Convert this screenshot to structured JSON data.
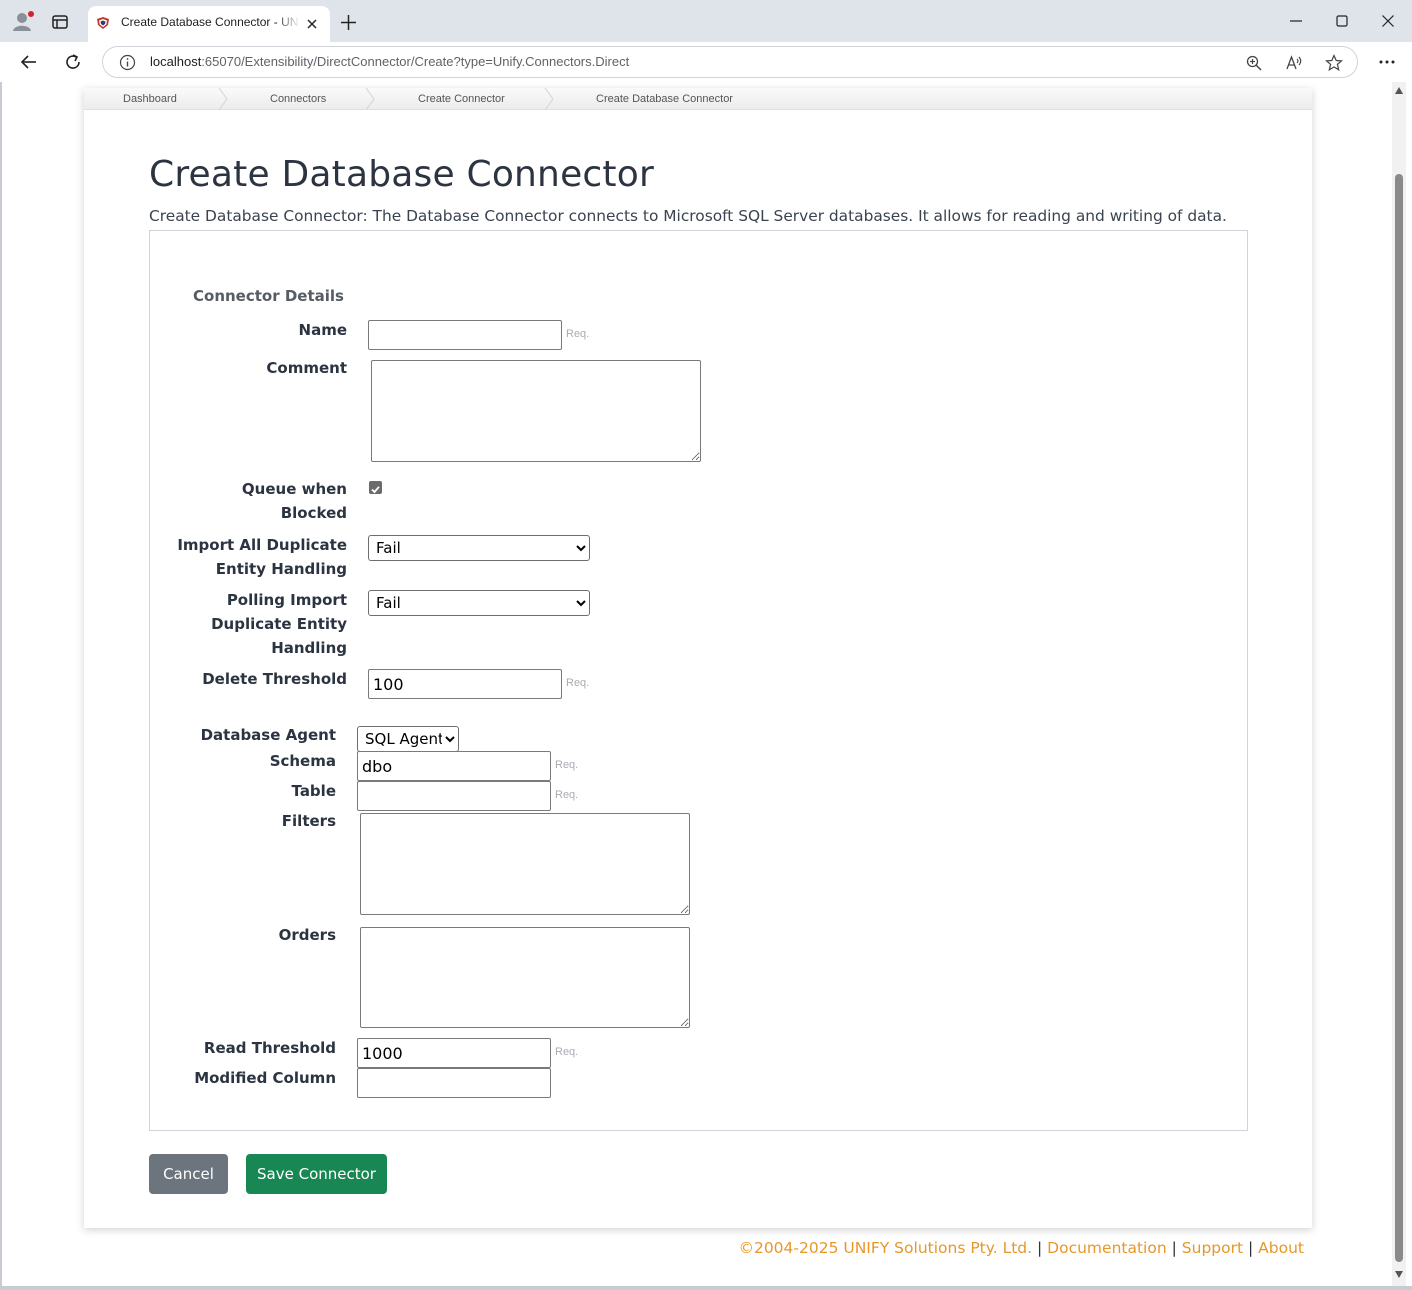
{
  "browser": {
    "tab_title": "Create Database Connector - UNIFY",
    "url_host": "localhost",
    "url_rest": ":65070/Extensibility/DirectConnector/Create?type=Unify.Connectors.Direct",
    "icons": [
      "profile-icon",
      "tab-actions-icon",
      "app-favicon",
      "close-tab-icon",
      "new-tab-icon",
      "minimize-icon",
      "maximize-icon",
      "close-window-icon",
      "back-icon",
      "refresh-icon",
      "info-icon",
      "zoom-icon",
      "read-aloud-icon",
      "favorite-icon",
      "more-icon"
    ]
  },
  "breadcrumb": [
    "Dashboard",
    "Connectors",
    "Create Connector",
    "Create Database Connector"
  ],
  "page": {
    "title": "Create Database Connector",
    "description": "Create Database Connector: The Database Connector connects to Microsoft SQL Server databases. It allows for reading and writing of data."
  },
  "form": {
    "section_title": "Connector Details",
    "required_hint": "Req.",
    "name": {
      "label": "Name",
      "value": ""
    },
    "comment": {
      "label": "Comment",
      "value": ""
    },
    "queue_when_blocked": {
      "label_line1": "Queue when",
      "label_line2": "Blocked",
      "checked": true
    },
    "import_duplicate": {
      "label_line1": "Import All Duplicate",
      "label_line2": "Entity Handling",
      "selected": "Fail"
    },
    "polling_duplicate": {
      "label_line1": "Polling Import",
      "label_line2": "Duplicate Entity",
      "label_line3": "Handling",
      "selected": "Fail"
    },
    "delete_threshold": {
      "label": "Delete Threshold",
      "value": "100"
    },
    "database_agent": {
      "label": "Database Agent",
      "selected": "SQL Agent"
    },
    "schema": {
      "label": "Schema",
      "value": "dbo"
    },
    "table": {
      "label": "Table",
      "value": ""
    },
    "filters": {
      "label": "Filters",
      "value": ""
    },
    "orders": {
      "label": "Orders",
      "value": ""
    },
    "read_threshold": {
      "label": "Read Threshold",
      "value": "1000"
    },
    "modified_column": {
      "label": "Modified Column",
      "value": ""
    }
  },
  "buttons": {
    "cancel": "Cancel",
    "save": "Save Connector"
  },
  "footer": {
    "copyright": "©2004-2025 UNIFY Solutions Pty. Ltd.",
    "sep": "|",
    "documentation": "Documentation",
    "support": "Support",
    "about": "About"
  },
  "colors": {
    "save_button": "#198754",
    "cancel_button": "#6c757d",
    "footer_link": "#e8972a",
    "title_text": "#2b3440"
  }
}
